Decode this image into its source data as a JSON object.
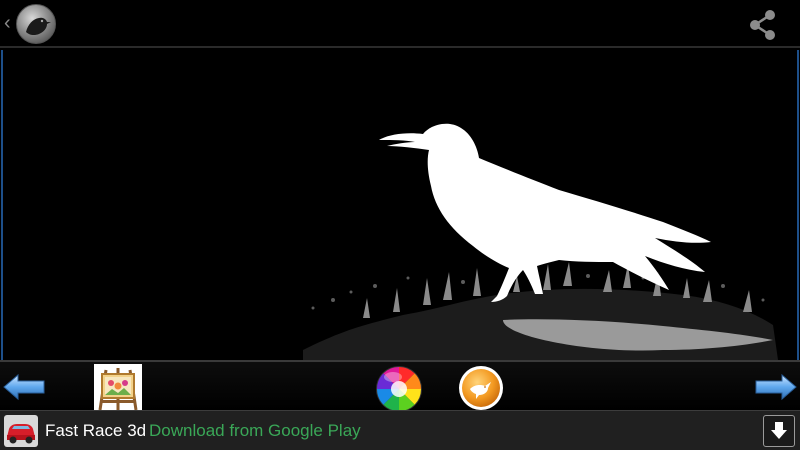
{
  "action_bar": {
    "up_icon": "chevron-left-icon",
    "app_icon": "raven-avatar-icon",
    "share_icon": "share-icon"
  },
  "canvas": {
    "content": "white raven silhouette on black background",
    "colors": {
      "background": "#000000",
      "subject": "#ffffff",
      "frame": "#1d4f8a"
    }
  },
  "toolbar": {
    "left_arrow_icon": "arrow-left-icon",
    "gallery_icon": "easel-gallery-icon",
    "color_icon": "color-wheel-icon",
    "bird_icon": "bird-badge-icon",
    "right_arrow_icon": "arrow-right-icon"
  },
  "ad": {
    "app_icon": "car-icon",
    "title": "Fast Race 3d",
    "cta": "Download from Google Play",
    "download_icon": "download-arrow-icon",
    "colors": {
      "title": "#ffffff",
      "cta": "#3aa757",
      "background": "#202020"
    }
  }
}
